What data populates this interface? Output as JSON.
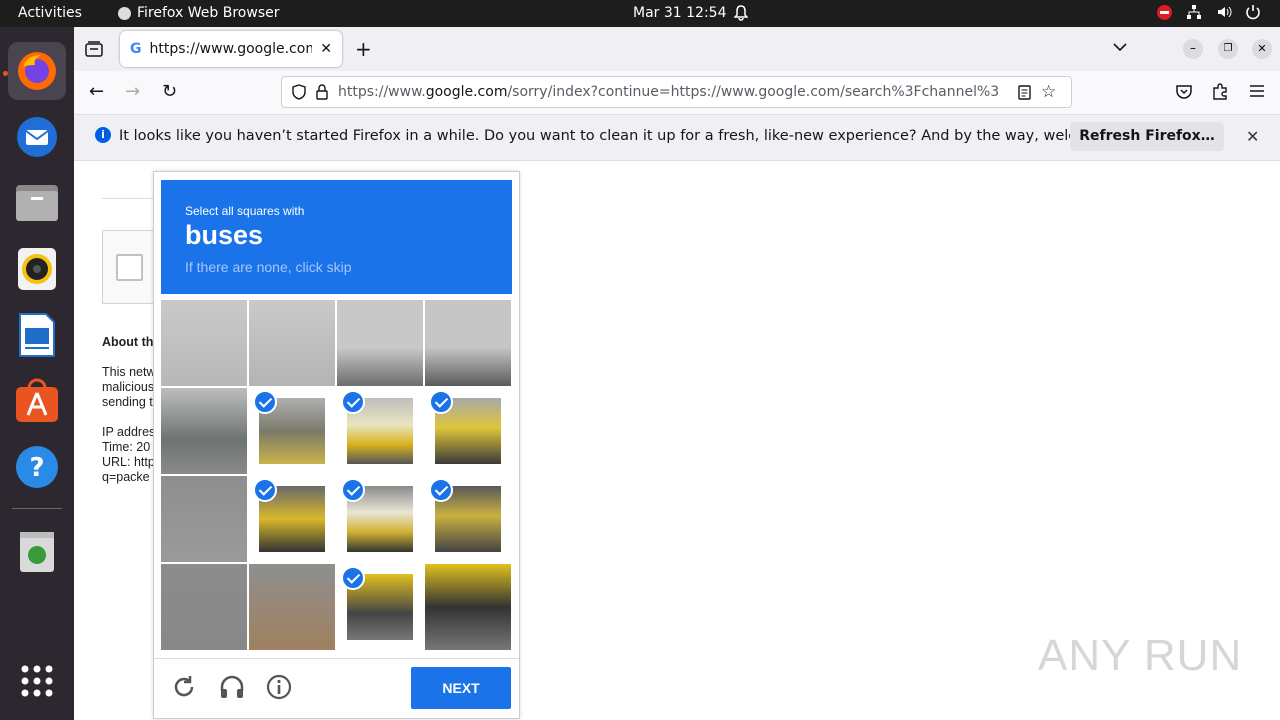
{
  "topbar": {
    "activities": "Activities",
    "app_name": "Firefox Web Browser",
    "datetime": "Mar 31  12:54"
  },
  "browser": {
    "tab_title": "https://www.google.com/",
    "url_prefix": "https://www.",
    "url_domain": "google.com",
    "url_rest": "/sorry/index?continue=https://www.google.com/search%3Fchannel%3"
  },
  "notification": {
    "message": "It looks like you haven’t started Firefox in a while. Do you want to clean it up for a fresh, like-new experience? And by the way, welcome back!",
    "button": "Refresh Firefox…"
  },
  "page": {
    "about": "About th",
    "para1": [
      "This netw",
      "malicious",
      "sending t"
    ],
    "para2": [
      "IP addres",
      "Time: 20",
      "URL: http",
      "q=packe"
    ]
  },
  "captcha": {
    "instruction": "Select all squares with",
    "target": "buses",
    "hint": "If there are none, click skip",
    "next": "NEXT",
    "selected": [
      5,
      6,
      7,
      9,
      10,
      11,
      14
    ]
  },
  "watermark": "ANY RUN"
}
